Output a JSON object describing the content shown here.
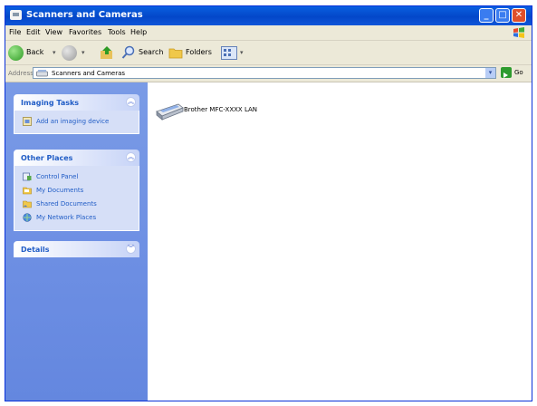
{
  "window": {
    "title": "Scanners and Cameras"
  },
  "menu": [
    "File",
    "Edit",
    "View",
    "Favorites",
    "Tools",
    "Help"
  ],
  "toolbar": {
    "back_label": "Back",
    "search_label": "Search",
    "folders_label": "Folders"
  },
  "address": {
    "label": "Address",
    "value": "Scanners and Cameras",
    "go_label": "Go"
  },
  "imaging_tasks": {
    "title": "Imaging Tasks",
    "items": [
      {
        "label": "Add an imaging device"
      }
    ]
  },
  "other_places": {
    "title": "Other Places",
    "items": [
      {
        "label": "Control Panel"
      },
      {
        "label": "My Documents"
      },
      {
        "label": "Shared Documents"
      },
      {
        "label": "My Network Places"
      }
    ]
  },
  "details": {
    "title": "Details"
  },
  "devices": [
    {
      "name": "Brother MFC-XXXX LAN"
    }
  ],
  "colors": {
    "titlebar": "#0a5fe0",
    "taskpane": "#6c8ee3",
    "link": "#215dc6"
  }
}
